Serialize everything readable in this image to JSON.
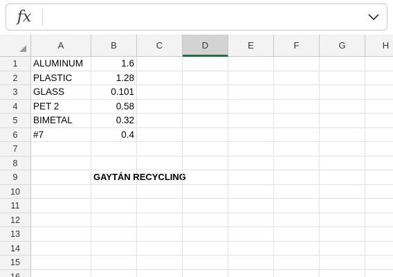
{
  "formula_bar": {
    "fx_label": "fx",
    "value": "",
    "expand_icon": "chevron-down-icon"
  },
  "columns": [
    "A",
    "B",
    "C",
    "D",
    "E",
    "F",
    "G",
    "H"
  ],
  "selected_column": "D",
  "rows": [
    "1",
    "2",
    "3",
    "4",
    "5",
    "6",
    "7",
    "8",
    "9",
    "10",
    "11",
    "12",
    "13",
    "14",
    "15",
    "16"
  ],
  "cells": {
    "A1": "ALUMINUM",
    "B1": "1.6",
    "A2": "PLASTIC",
    "B2": "1.28",
    "A3": "GLASS",
    "B3": "0.101",
    "A4": "PET 2",
    "B4": "0.58",
    "A5": "BIMETAL",
    "B5": "0.32",
    "A6": "#7",
    "B6": "0.4",
    "B9": "GAYTÁN RECYCLING"
  },
  "colors": {
    "selected_accent": "#1e7145",
    "header_bg": "#f3f3f3"
  }
}
